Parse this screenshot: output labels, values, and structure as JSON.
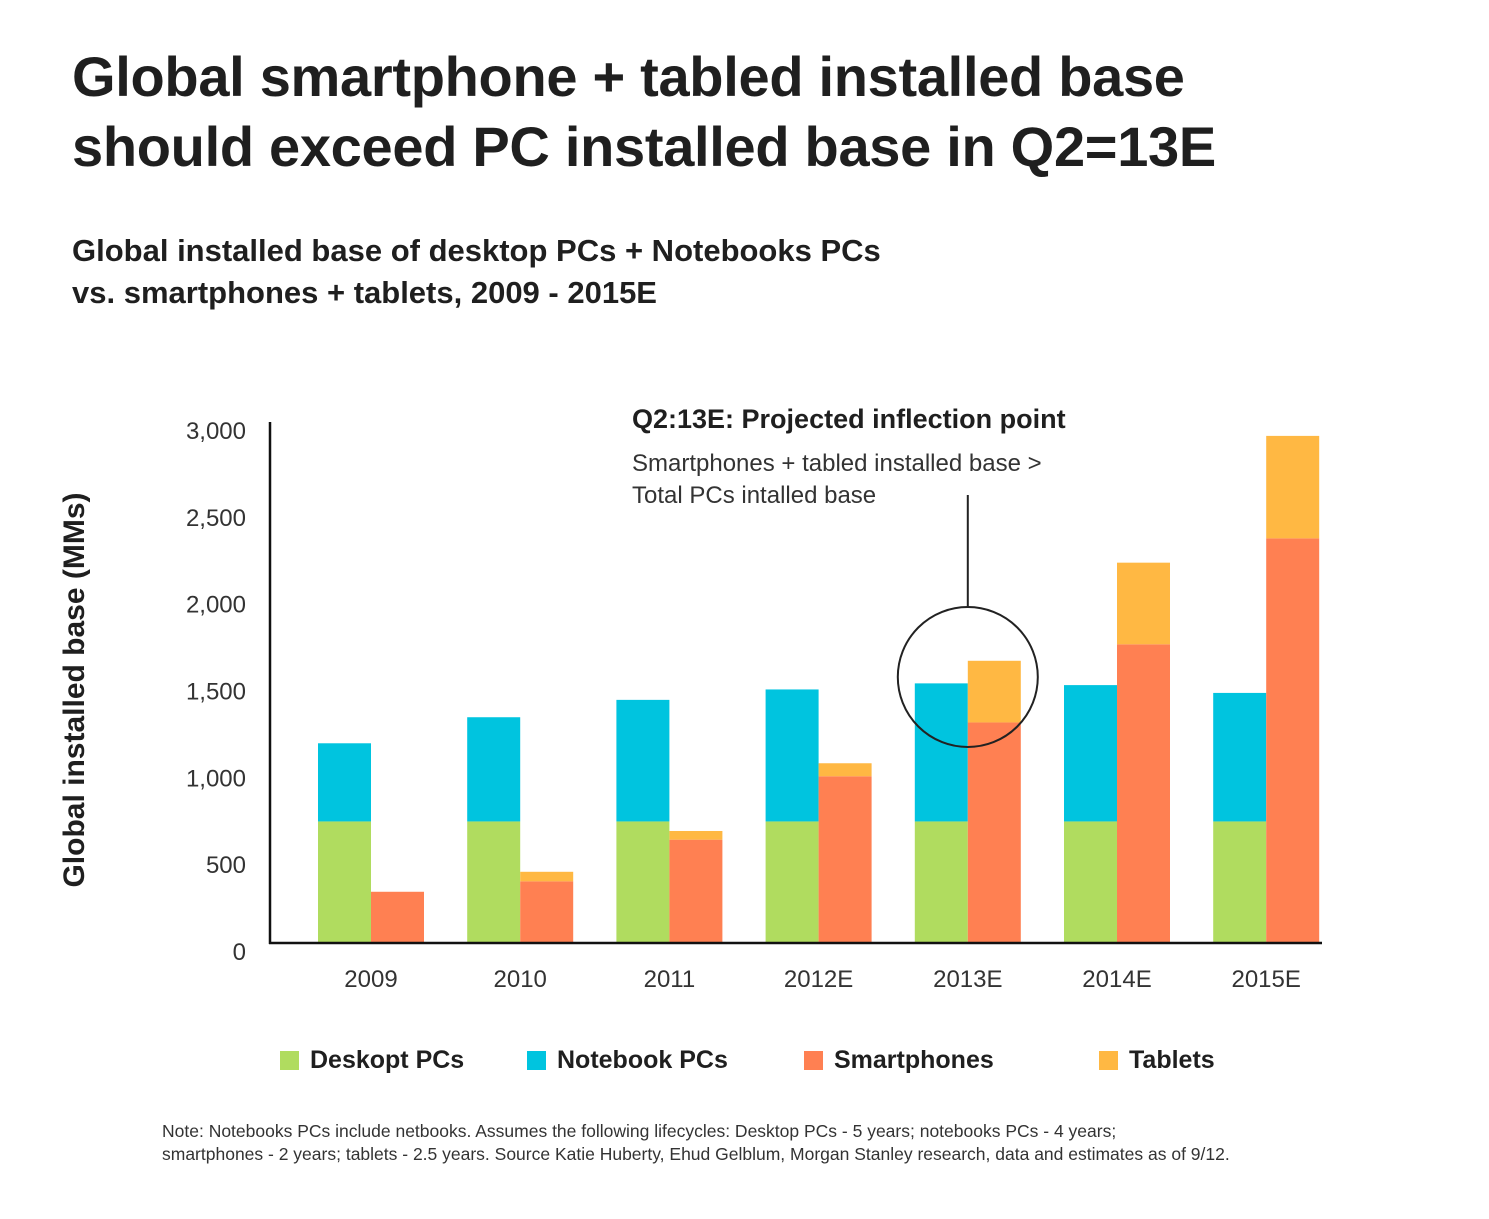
{
  "title": {
    "line1": "Global smartphone + tabled installed base",
    "line2": "should exceed PC installed base in Q2=13E"
  },
  "subtitle": {
    "line1": "Global installed base of desktop PCs + Notebooks PCs",
    "line2": "vs. smartphones + tablets, 2009 - 2015E"
  },
  "colors": {
    "desktop": "#b0dc5f",
    "notebook": "#00c4df",
    "smartphone": "#ff8052",
    "tablet": "#ffb843",
    "axis": "#111111",
    "annotation": "#222222"
  },
  "annotation": {
    "title": "Q2:13E: Projected inflection point",
    "line1": "Smartphones + tabled installed base >",
    "line2": "Total PCs intalled base",
    "target_category": "2013E"
  },
  "legend": [
    {
      "label": "Deskopt PCs",
      "color_key": "desktop"
    },
    {
      "label": "Notebook PCs",
      "color_key": "notebook"
    },
    {
      "label": "Smartphones",
      "color_key": "smartphone"
    },
    {
      "label": "Tablets",
      "color_key": "tablet"
    }
  ],
  "note": {
    "line1": "Note: Notebooks PCs include netbooks. Assumes the following lifecycles: Desktop PCs - 5 years; notebooks PCs - 4 years;",
    "line2": "smartphones - 2 years; tablets - 2.5 years. Source Katie Huberty, Ehud Gelblum, Morgan Stanley research, data and estimates as of 9/12."
  },
  "chart_data": {
    "type": "bar",
    "stacked": true,
    "title": "Global installed base of desktop PCs + Notebooks PCs vs. smartphones + tablets, 2009 - 2015E",
    "xlabel": "",
    "ylabel": "Global installed base (MMs)",
    "ylim": [
      0,
      3000
    ],
    "yticks": [
      0,
      500,
      1000,
      1500,
      2000,
      2500,
      3000
    ],
    "ytick_labels": [
      "0",
      "500",
      "1,000",
      "1,500",
      "2,000",
      "2,500",
      "3,000"
    ],
    "grid": false,
    "legend_position": "bottom",
    "categories": [
      "2009",
      "2010",
      "2011",
      "2012E",
      "2013E",
      "2014E",
      "2015E"
    ],
    "stacks": [
      {
        "name": "PCs",
        "series": [
          "Deskopt PCs",
          "Notebook PCs"
        ]
      },
      {
        "name": "Mobile",
        "series": [
          "Smartphones",
          "Tablets"
        ]
      }
    ],
    "series": [
      {
        "name": "Deskopt PCs",
        "stack": "PCs",
        "color_key": "desktop",
        "values": [
          700,
          700,
          700,
          700,
          700,
          700,
          700
        ]
      },
      {
        "name": "Notebook PCs",
        "stack": "PCs",
        "color_key": "notebook",
        "values": [
          450,
          600,
          700,
          760,
          795,
          785,
          740
        ]
      },
      {
        "name": "Smartphones",
        "stack": "Mobile",
        "color_key": "smartphone",
        "values": [
          295,
          355,
          595,
          960,
          1270,
          1720,
          2330
        ]
      },
      {
        "name": "Tablets",
        "stack": "Mobile",
        "color_key": "tablet",
        "values": [
          0,
          55,
          50,
          75,
          355,
          470,
          590
        ]
      }
    ]
  }
}
